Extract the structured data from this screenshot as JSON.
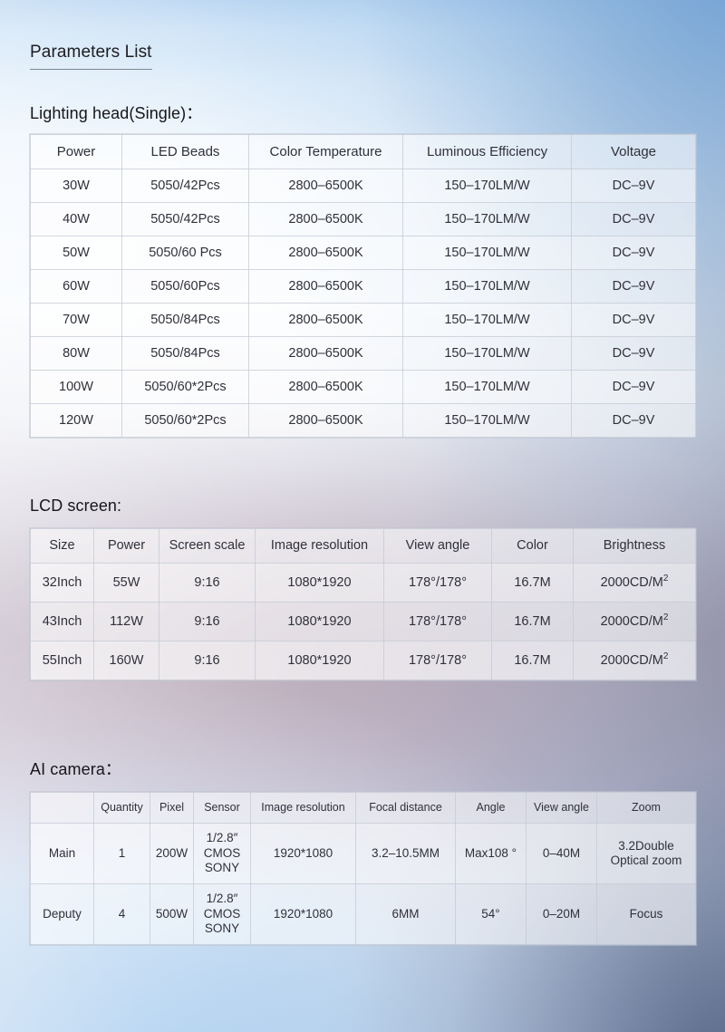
{
  "page": {
    "title": "Parameters List"
  },
  "sections": [
    {
      "heading": "Lighting head(Single)：",
      "table_id": "lighting-head-table",
      "columns": [
        "Power",
        "LED Beads",
        "Color Temperature",
        "Luminous Efficiency",
        "Voltage"
      ],
      "rows": [
        [
          "30W",
          "5050/42Pcs",
          "2800–6500K",
          "150–170LM/W",
          "DC–9V"
        ],
        [
          "40W",
          "5050/42Pcs",
          "2800–6500K",
          "150–170LM/W",
          "DC–9V"
        ],
        [
          "50W",
          "5050/60 Pcs",
          "2800–6500K",
          "150–170LM/W",
          "DC–9V"
        ],
        [
          "60W",
          "5050/60Pcs",
          "2800–6500K",
          "150–170LM/W",
          "DC–9V"
        ],
        [
          "70W",
          "5050/84Pcs",
          "2800–6500K",
          "150–170LM/W",
          "DC–9V"
        ],
        [
          "80W",
          "5050/84Pcs",
          "2800–6500K",
          "150–170LM/W",
          "DC–9V"
        ],
        [
          "100W",
          "5050/60*2Pcs",
          "2800–6500K",
          "150–170LM/W",
          "DC–9V"
        ],
        [
          "120W",
          "5050/60*2Pcs",
          "2800–6500K",
          "150–170LM/W",
          "DC–9V"
        ]
      ]
    },
    {
      "heading": "LCD screen:",
      "table_id": "lcd-screen-table",
      "columns": [
        "Size",
        "Power",
        "Screen scale",
        "Image resolution",
        "View angle",
        "Color",
        "Brightness"
      ],
      "rows": [
        [
          "32Inch",
          "55W",
          "9:16",
          "1080*1920",
          "178°/178°",
          "16.7M",
          "2000CD/M2"
        ],
        [
          "43Inch",
          "112W",
          "9:16",
          "1080*1920",
          "178°/178°",
          "16.7M",
          "2000CD/M2"
        ],
        [
          "55Inch",
          "160W",
          "9:16",
          "1080*1920",
          "178°/178°",
          "16.7M",
          "2000CD/M2"
        ]
      ],
      "brightness_base": "2000CD/M",
      "brightness_sup": "2"
    },
    {
      "heading": "AI camera：",
      "table_id": "ai-camera-table",
      "columns": [
        "",
        "Quantity",
        "Pixel",
        "Sensor",
        "Image resolution",
        "Focal distance",
        "Angle",
        "View angle",
        "Zoom"
      ],
      "rows": [
        {
          "label": "Main",
          "quantity": "1",
          "pixel": "200W",
          "sensor_line1": "1/2.8″",
          "sensor_line2": "CMOS",
          "sensor_line3": "SONY",
          "image_resolution": "1920*1080",
          "focal_distance": "3.2–10.5MM",
          "angle": "Max108 °",
          "view_angle": "0–40M",
          "zoom_line1": "3.2Double",
          "zoom_line2": "Optical zoom"
        },
        {
          "label": "Deputy",
          "quantity": "4",
          "pixel": "500W",
          "sensor_line1": "1/2.8″",
          "sensor_line2": "CMOS",
          "sensor_line3": "SONY",
          "image_resolution": "1920*1080",
          "focal_distance": "6MM",
          "angle": "54°",
          "view_angle": "0–20M",
          "zoom_line1": "Focus",
          "zoom_line2": ""
        }
      ]
    }
  ],
  "colors": {
    "text": "#30303a",
    "heading": "#16161b",
    "title_underline": "#7e8690",
    "cell_border": "#c4cad4",
    "bg_blue": "#a8cbee",
    "bg_mauve": "#c2b8c6",
    "bg_dark_slate": "#4e5c7c"
  }
}
